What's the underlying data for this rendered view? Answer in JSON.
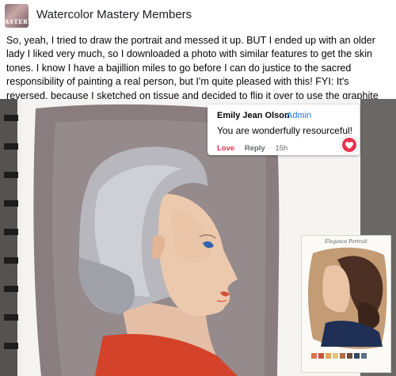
{
  "header": {
    "group_name": "Watercolor Mastery Members",
    "avatar_text": "ASTERY"
  },
  "post": {
    "text": "So, yeah, I tried to draw the portrait and messed it up. BUT I ended up with an older lady I liked very much, so I downloaded a photo with similar features to get the skin tones. I know I have a bajillion miles to go before I can do justice to the sacred responsibility of painting a real person, but I'm quite pleased with this! FYI: It's reversed, because I sketched on tissue and decided to flip it over to use the graphite that was already there to transfer it to my journal."
  },
  "comment": {
    "author": "Emily Jean Olson",
    "badge": "Admin",
    "text": "You are wonderfully resourceful!",
    "love_label": "Love",
    "reply_label": "Reply",
    "time": "15h",
    "reaction_icon": "heart-icon"
  },
  "reference_image": {
    "title": "Elegance Portrait"
  },
  "colors": {
    "love": "#e8314d",
    "admin_badge": "#1877f2",
    "background": "#5a5a58"
  }
}
